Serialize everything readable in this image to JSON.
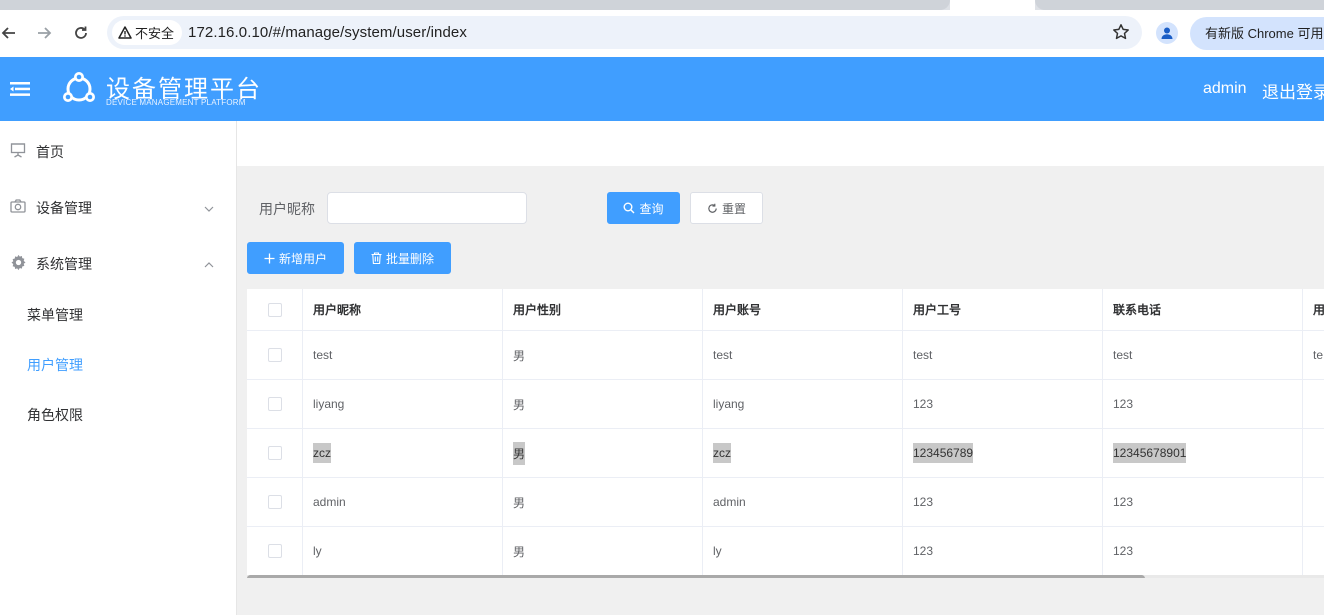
{
  "browser": {
    "security_label": "不安全",
    "url": "172.16.0.10/#/manage/system/user/index",
    "update_label": "有新版 Chrome 可用"
  },
  "header": {
    "title": "设备管理平台",
    "subtitle": "DEVICE MANAGEMENT PLATFORM",
    "username": "admin",
    "logout_label": "退出登录",
    "color": "#409eff"
  },
  "sidebar": {
    "items": [
      {
        "label": "首页",
        "icon": "easel-icon"
      },
      {
        "label": "设备管理",
        "icon": "camera-icon"
      },
      {
        "label": "系统管理",
        "icon": "gear-icon"
      }
    ],
    "sub_items": [
      {
        "label": "菜单管理"
      },
      {
        "label": "用户管理",
        "active": true
      },
      {
        "label": "角色权限"
      }
    ]
  },
  "search": {
    "label": "用户昵称",
    "value": "",
    "query_label": "查询",
    "reset_label": "重置"
  },
  "actions": {
    "add_label": "新增用户",
    "batch_delete_label": "批量删除"
  },
  "table": {
    "columns": [
      "用户昵称",
      "用户性别",
      "用户账号",
      "用户工号",
      "联系电话",
      "用"
    ],
    "rows": [
      [
        "test",
        "男",
        "test",
        "test",
        "test",
        "te"
      ],
      [
        "liyang",
        "男",
        "liyang",
        "123",
        "123",
        ""
      ],
      [
        "zcz",
        "男",
        "zcz",
        "123456789",
        "12345678901",
        ""
      ],
      [
        "admin",
        "男",
        "admin",
        "123",
        "123",
        ""
      ],
      [
        "ly",
        "男",
        "ly",
        "123",
        "123",
        ""
      ]
    ]
  }
}
